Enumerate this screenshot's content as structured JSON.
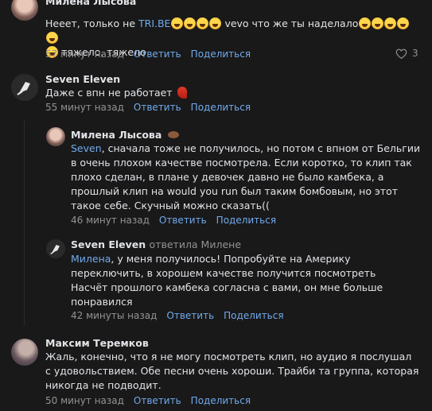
{
  "comments": [
    {
      "author": "Милена Лысова",
      "text_parts": [
        "Нееет, только не ",
        "TRI.BE",
        " vevo что же ты наделало",
        " тяжело, тяжело"
      ],
      "time": "57 минут назад",
      "reply": "Ответить",
      "share": "Поделиться",
      "likes": "3"
    },
    {
      "author": "Seven Eleven",
      "text": "Даже с впн не работает",
      "time": "55 минут назад",
      "reply": "Ответить",
      "share": "Поделиться"
    },
    {
      "author": "Милена Лысова",
      "mention": "Seven",
      "text": ", сначала тоже не получилось, но потом с впном от Бельгии в очень плохом качестве посмотрела. Если коротко, то клип так плохо сделан, в плане у девочек давно не было камбека, а прошлый клип на would you run был таким бомбовым, но этот такое себе. Скучный можно сказать((",
      "time": "46 минут назад",
      "reply": "Ответить",
      "share": "Поделиться"
    },
    {
      "author": "Seven Eleven",
      "replied_to": "ответила Милене",
      "mention": "Милена",
      "text": ", у меня получилось! Попробуйте на Америку переключить, в хорошем качестве получится посмотреть",
      "text2": "Насчёт прошлого камбека согласна с вами, он мне больше понравился",
      "time": "42 минуты назад",
      "reply": "Ответить",
      "share": "Поделиться"
    },
    {
      "author": "Максим Теремков",
      "text": "Жаль, конечно, что я не могу посмотреть клип, но аудио я послушал с удовольствием. Обе песни очень хороши. Трайби та группа, которая никогда не подводит.",
      "time": "50 минут назад",
      "reply": "Ответить",
      "share": "Поделиться"
    }
  ],
  "colors": {
    "background": "#19191a",
    "link": "#71aaeb",
    "muted": "#939393",
    "text": "#e1e3e6"
  }
}
